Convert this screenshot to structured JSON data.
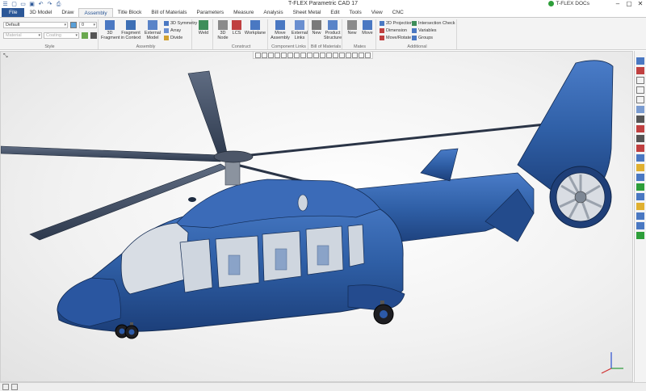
{
  "window": {
    "title": "T-FLEX Parametric CAD 17",
    "docs_label": "T-FLEX DOCs"
  },
  "quick_access": [
    "menu-icon",
    "new-icon",
    "open-icon",
    "save-icon",
    "undo-icon",
    "redo-icon",
    "print-icon"
  ],
  "tabs": [
    "File",
    "3D Model",
    "Draw",
    "Assembly",
    "Title Block",
    "Bill of Materials",
    "Parameters",
    "Measure",
    "Analysis",
    "Sheet Metal",
    "Edit",
    "Tools",
    "View",
    "CNC"
  ],
  "active_tab": "Assembly",
  "ribbon": {
    "style": {
      "label": "Style",
      "style_value": "Default",
      "width_value": "0",
      "material_placeholder": "Material",
      "coating_placeholder": "Coating"
    },
    "assembly": {
      "label": "Assembly",
      "fragment": "3D Fragment",
      "fragment_in_context": "Fragment in Context",
      "external_model": "External Model",
      "symmetry": "3D Symmetry",
      "array": "Array",
      "divide": "Divide"
    },
    "weld": {
      "label": "Weld"
    },
    "construct": {
      "label": "Construct",
      "node": "3D Node",
      "lcs": "LCS",
      "workplane": "Workplane"
    },
    "component_links": {
      "label": "Component Links",
      "move_assembly": "Move Assembly",
      "external_links": "External Links"
    },
    "bom": {
      "label": "Bill of Materials",
      "new": "New",
      "product_structure": "Product Structure"
    },
    "mates": {
      "label": "Mates",
      "new": "New",
      "move": "Move"
    },
    "additional": {
      "label": "Additional",
      "projection": "2D Projection",
      "dimension": "Dimension",
      "move_rotate": "Move/Rotate",
      "intersection_check": "Intersection Check",
      "variables": "Variables",
      "groups": "Groups"
    }
  },
  "colors": {
    "accent": "#2b5797",
    "model_blue": "#2f5fa6",
    "model_dark": "#1a3566"
  }
}
